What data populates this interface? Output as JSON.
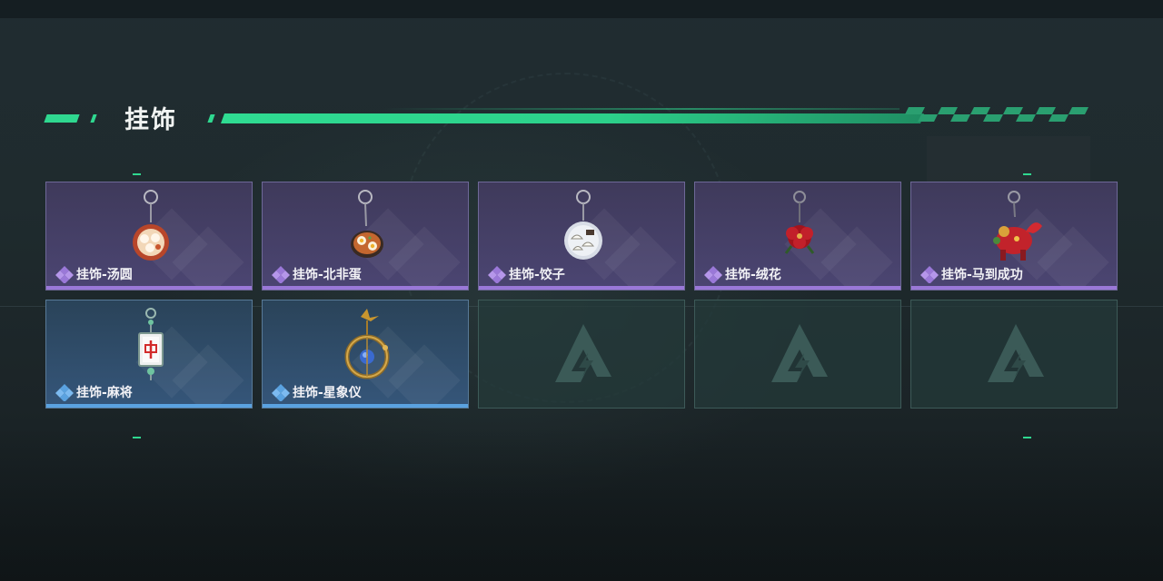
{
  "section": {
    "title": "挂饰"
  },
  "colors": {
    "accent_green": "#2fd890",
    "purple_card": "#4b4572",
    "purple_rarity": "#9a78d8",
    "blue_card": "#35567a",
    "blue_rarity": "#5aa2e0",
    "empty_slot": "#243a3a"
  },
  "items": [
    {
      "name": "挂饰-汤圆",
      "rarity": "purple",
      "icon": "tangyuan-charm-icon"
    },
    {
      "name": "挂饰-北非蛋",
      "rarity": "purple",
      "icon": "shakshuka-charm-icon"
    },
    {
      "name": "挂饰-饺子",
      "rarity": "purple",
      "icon": "dumplings-charm-icon"
    },
    {
      "name": "挂饰-绒花",
      "rarity": "purple",
      "icon": "velvet-flower-charm-icon"
    },
    {
      "name": "挂饰-马到成功",
      "rarity": "purple",
      "icon": "horse-charm-icon"
    },
    {
      "name": "挂饰-麻将",
      "rarity": "blue",
      "icon": "mahjong-tile-charm-icon"
    },
    {
      "name": "挂饰-星象仪",
      "rarity": "blue",
      "icon": "astrolabe-charm-icon"
    }
  ],
  "empty_slots": [
    {
      "icon": "locked-slot-logo-icon"
    },
    {
      "icon": "locked-slot-logo-icon"
    },
    {
      "icon": "locked-slot-logo-icon"
    }
  ]
}
